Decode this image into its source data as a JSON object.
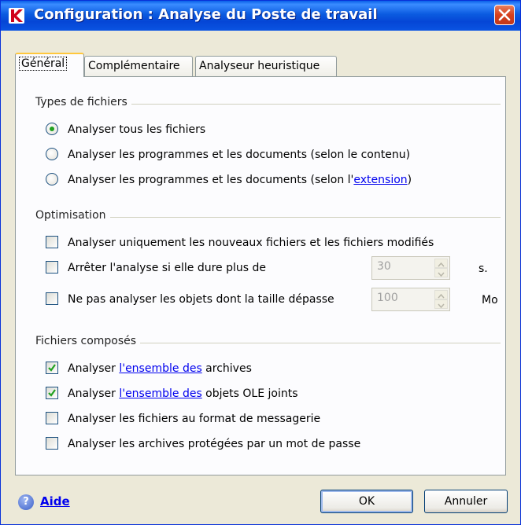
{
  "window": {
    "title": "Configuration : Analyse du Poste de travail",
    "icon": "kaspersky-k-icon",
    "close_icon": "close-icon"
  },
  "tabs": [
    {
      "label": "Général",
      "active": true
    },
    {
      "label": "Complémentaire",
      "active": false
    },
    {
      "label": "Analyseur heuristique",
      "active": false
    }
  ],
  "file_types": {
    "title": "Types de fichiers",
    "options": [
      {
        "label": "Analyser tous les fichiers",
        "selected": true
      },
      {
        "label": "Analyser les programmes et les documents (selon le contenu)",
        "selected": false
      },
      {
        "label_prefix": "Analyser les programmes et les documents (selon l'",
        "link": "extension",
        "label_suffix": ")",
        "selected": false
      }
    ]
  },
  "optimisation": {
    "title": "Optimisation",
    "only_new": {
      "label": "Analyser uniquement les nouveaux fichiers et les fichiers modifiés",
      "checked": false
    },
    "stop_after": {
      "label": "Arrêter l'analyse si elle dure plus de",
      "checked": false,
      "value": "30",
      "unit": "s."
    },
    "skip_size": {
      "label": "Ne pas analyser les objets dont la taille dépasse",
      "checked": false,
      "value": "100",
      "unit": "Mo"
    }
  },
  "compound": {
    "title": "Fichiers composés",
    "archives": {
      "prefix": "Analyser ",
      "link": "l'ensemble des",
      "suffix": " archives",
      "checked": true
    },
    "ole": {
      "prefix": "Analyser ",
      "link": "l'ensemble des",
      "suffix": " objets OLE joints",
      "checked": true
    },
    "mail": {
      "label": "Analyser les fichiers au format de messagerie",
      "checked": false
    },
    "protected": {
      "label": "Analyser les archives protégées par un mot de passe",
      "checked": false
    }
  },
  "footer": {
    "help": "Aide",
    "ok": "OK",
    "cancel": "Annuler"
  },
  "colors": {
    "titlebar": "#0A5FE8",
    "dialog_bg": "#ECE9D8",
    "link": "#0000EE",
    "check_green": "#21A121"
  }
}
